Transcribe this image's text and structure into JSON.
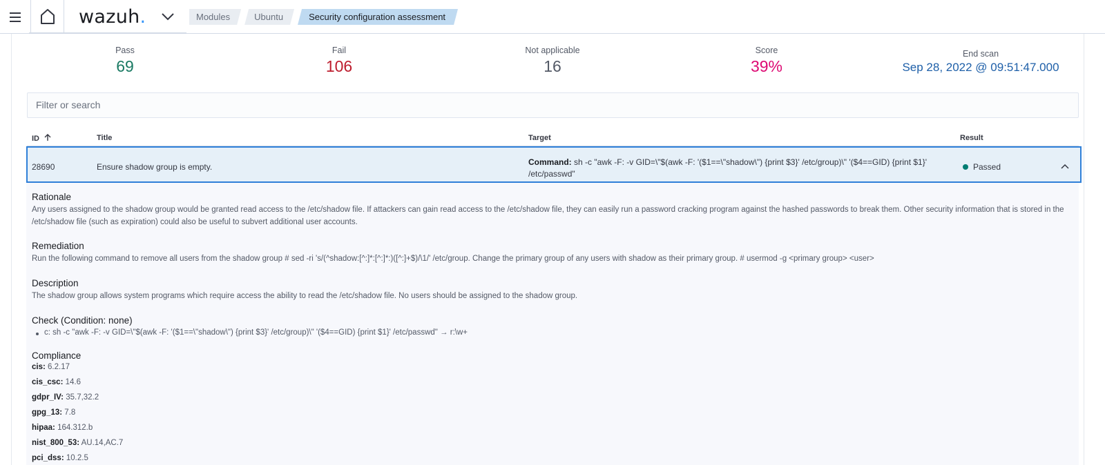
{
  "header": {
    "logo_text": "wazuh",
    "logo_dot": ".",
    "breadcrumbs": [
      "Modules",
      "Ubuntu",
      "Security configuration assessment"
    ]
  },
  "stats": {
    "pass": {
      "label": "Pass",
      "value": "69",
      "color": "#1a7a63"
    },
    "fail": {
      "label": "Fail",
      "value": "106",
      "color": "#bd1c2d"
    },
    "na": {
      "label": "Not applicable",
      "value": "16",
      "color": "#535966"
    },
    "score": {
      "label": "Score",
      "value": "39%",
      "color": "#dd0a73"
    },
    "end_scan": {
      "label": "End scan",
      "value": "Sep 28, 2022 @ 09:51:47.000",
      "color": "#1e5fa8"
    }
  },
  "search": {
    "placeholder": "Filter or search"
  },
  "table": {
    "columns": {
      "id": "ID",
      "title": "Title",
      "target": "Target",
      "result": "Result"
    },
    "row": {
      "id": "28690",
      "title": "Ensure shadow group is empty.",
      "target_label": "Command:",
      "target_value": " sh -c \"awk -F: -v GID=\\\"$(awk -F: '($1==\\\"shadow\\\") {print $3}' /etc/group)\\\" '($4==GID) {print $1}' /etc/passwd\"",
      "result": "Passed"
    }
  },
  "details": {
    "rationale_title": "Rationale",
    "rationale_text": "Any users assigned to the shadow group would be granted read access to the /etc/shadow file. If attackers can gain read access to the /etc/shadow file, they can easily run a password cracking program against the hashed passwords to break them. Other security information that is stored in the /etc/shadow file (such as expiration) could also be useful to subvert additional user accounts.",
    "remediation_title": "Remediation",
    "remediation_text": "Run the following command to remove all users from the shadow group # sed -ri 's/(^shadow:[^:]*:[^:]*:)([^:]+$)/\\1/' /etc/group. Change the primary group of any users with shadow as their primary group. # usermod -g <primary group> <user>",
    "description_title": "Description",
    "description_text": "The shadow group allows system programs which require access the ability to read the /etc/shadow file. No users should be assigned to the shadow group.",
    "check_title": "Check (Condition: none)",
    "check_item": "c: sh -c \"awk -F: -v GID=\\\"$(awk -F: '($1==\\\"shadow\\\") {print $3}' /etc/group)\\\" '($4==GID) {print $1}' /etc/passwd\" → r:\\w+",
    "compliance_title": "Compliance",
    "compliance": [
      {
        "key": "cis:",
        "value": " 6.2.17"
      },
      {
        "key": "cis_csc:",
        "value": " 14.6"
      },
      {
        "key": "gdpr_IV:",
        "value": " 35.7,32.2"
      },
      {
        "key": "gpg_13:",
        "value": " 7.8"
      },
      {
        "key": "hipaa:",
        "value": " 164.312.b"
      },
      {
        "key": "nist_800_53:",
        "value": " AU.14,AC.7"
      },
      {
        "key": "pci_dss:",
        "value": " 10.2.5"
      }
    ]
  }
}
